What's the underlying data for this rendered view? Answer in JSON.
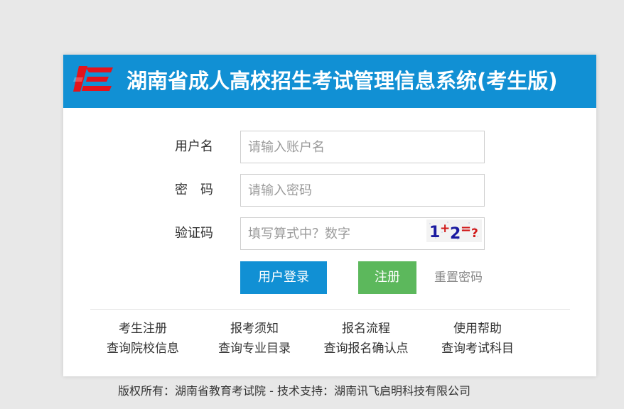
{
  "header": {
    "title": "湖南省成人高校招生考试管理信息系统(考生版)"
  },
  "form": {
    "username_label": "用户名",
    "username_placeholder": "请输入账户名",
    "password_label": "密　码",
    "password_placeholder": "请输入密码",
    "captcha_label": "验证码",
    "captcha_placeholder": "填写算式中？数字",
    "captcha_text": "1+2=?",
    "login_label": "用户登录",
    "register_label": "注册",
    "reset_label": "重置密码"
  },
  "links": [
    {
      "label": "考生注册"
    },
    {
      "label": "报考须知"
    },
    {
      "label": "报名流程"
    },
    {
      "label": "使用帮助"
    },
    {
      "label": "查询院校信息"
    },
    {
      "label": "查询专业目录"
    },
    {
      "label": "查询报名确认点"
    },
    {
      "label": "查询考试科目"
    }
  ],
  "footer": {
    "text": "版权所有：湖南省教育考试院 - 技术支持：湖南讯飞启明科技有限公司"
  },
  "colors": {
    "header_bg": "#1190d4",
    "login_bg": "#1190d4",
    "register_bg": "#5cb85c",
    "logo_red": "#e3131b"
  }
}
